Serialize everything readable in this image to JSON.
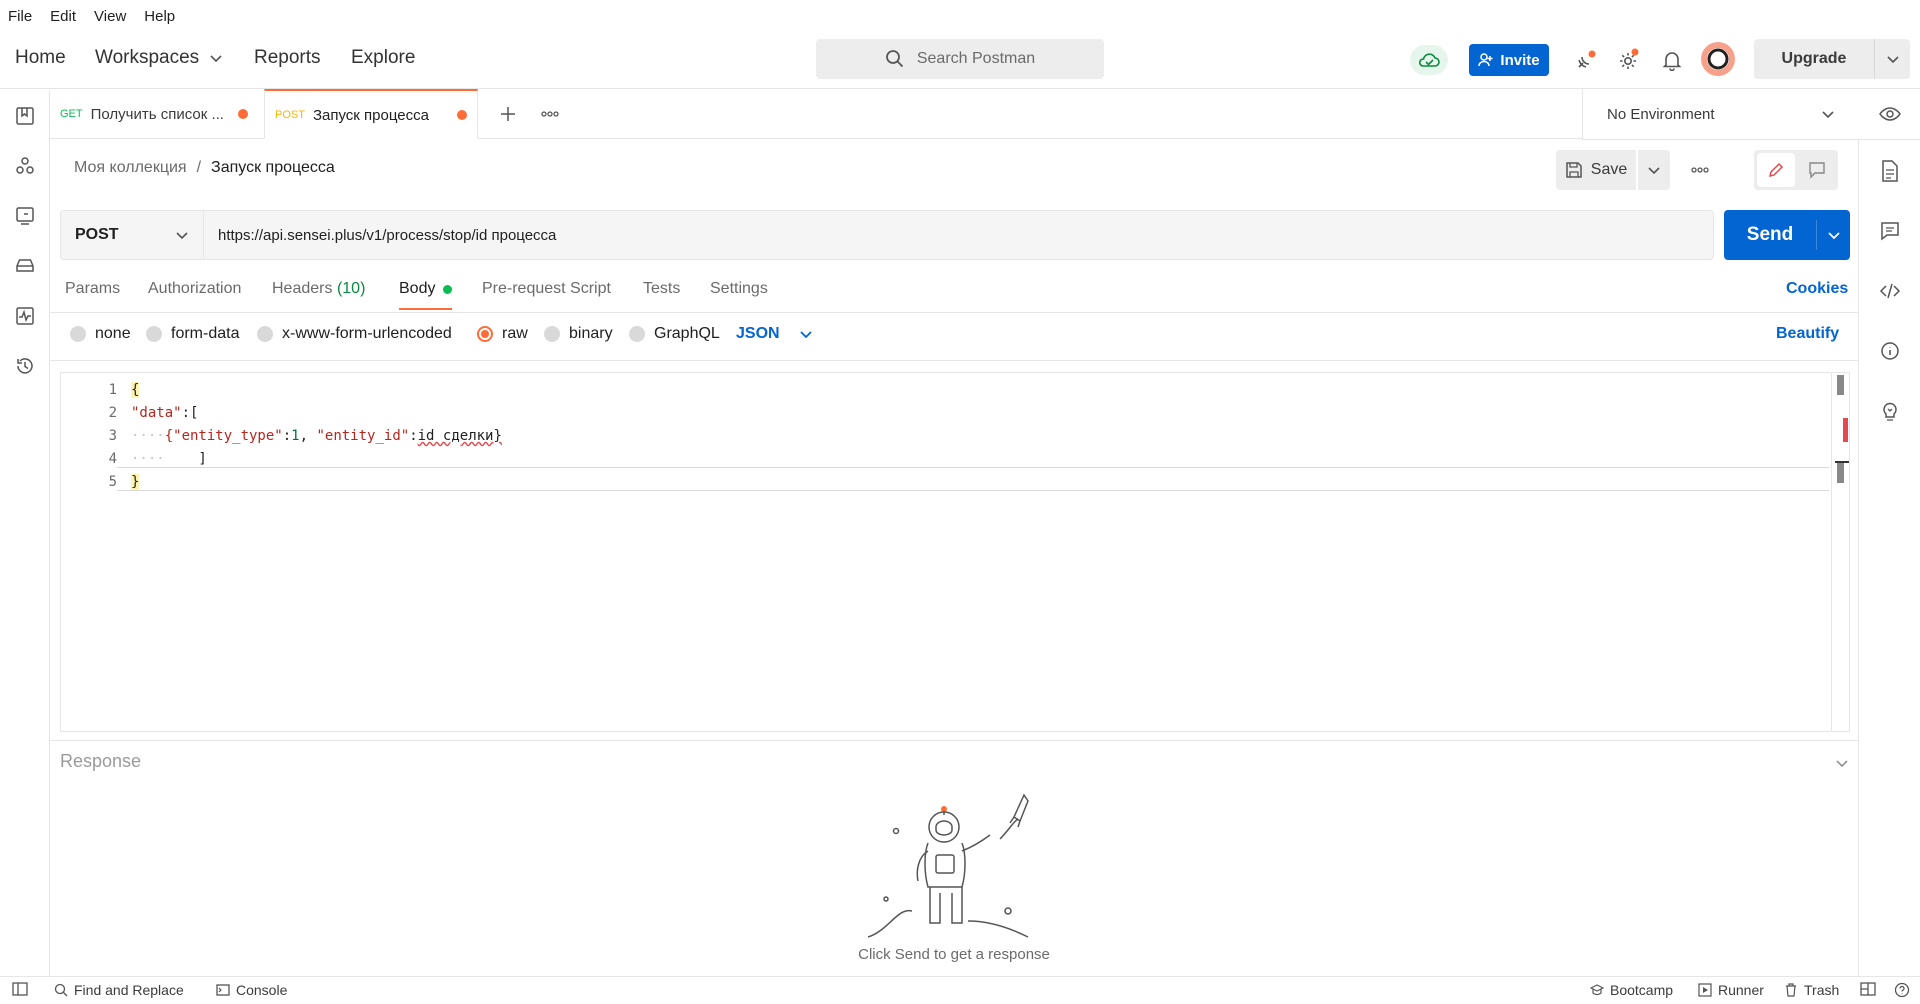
{
  "menu": [
    "File",
    "Edit",
    "View",
    "Help"
  ],
  "header": {
    "nav": {
      "home": "Home",
      "workspaces": "Workspaces",
      "reports": "Reports",
      "explore": "Explore"
    },
    "search_placeholder": "Search Postman",
    "invite": "Invite",
    "upgrade": "Upgrade"
  },
  "tabs": [
    {
      "method": "GET",
      "title": "Получить список ...",
      "method_color": "#0cbb52"
    },
    {
      "method": "POST",
      "title": "Запуск процесса",
      "method_color": "#ffb400"
    }
  ],
  "environment": "No Environment",
  "breadcrumb": {
    "collection": "Моя коллекция",
    "separator": "/",
    "request": "Запуск процесса"
  },
  "save": "Save",
  "request": {
    "method": "POST",
    "url": "https://api.sensei.plus/v1/process/stop/id процесса",
    "send": "Send"
  },
  "request_tabs": {
    "params": "Params",
    "authorization": "Authorization",
    "headers": "Headers",
    "headers_count": "(10)",
    "body": "Body",
    "prerequest": "Pre-request Script",
    "tests": "Tests",
    "settings": "Settings",
    "cookies": "Cookies"
  },
  "body_types": {
    "none": "none",
    "form_data": "form-data",
    "urlencoded": "x-www-form-urlencoded",
    "raw": "raw",
    "binary": "binary",
    "graphql": "GraphQL",
    "format": "JSON",
    "beautify": "Beautify",
    "selected": "raw"
  },
  "editor": {
    "line_numbers": [
      "1",
      "2",
      "3",
      "4",
      "5"
    ],
    "line1": "{",
    "line2_key": "\"data\"",
    "line2_rest": ":[",
    "line3_indent": "····",
    "line3_k1": "{\"entity_type\"",
    "line3_colon1": ":",
    "line3_v1": "1",
    "line3_comma": ", ",
    "line3_k2": "\"entity_id\"",
    "line3_colon2": ":",
    "line3_v2": "id сделки}",
    "line4_indent": "····",
    "line4_text": "    ]",
    "line5": "}"
  },
  "response": {
    "title": "Response",
    "empty_message": "Click Send to get a response"
  },
  "statusbar": {
    "find_replace": "Find and Replace",
    "console": "Console",
    "bootcamp": "Bootcamp",
    "runner": "Runner",
    "trash": "Trash"
  },
  "colors": {
    "accent": "#ff6c37",
    "primary": "#0265d2",
    "get": "#0cbb52",
    "post": "#ffb400",
    "ok": "#0cbb52"
  }
}
